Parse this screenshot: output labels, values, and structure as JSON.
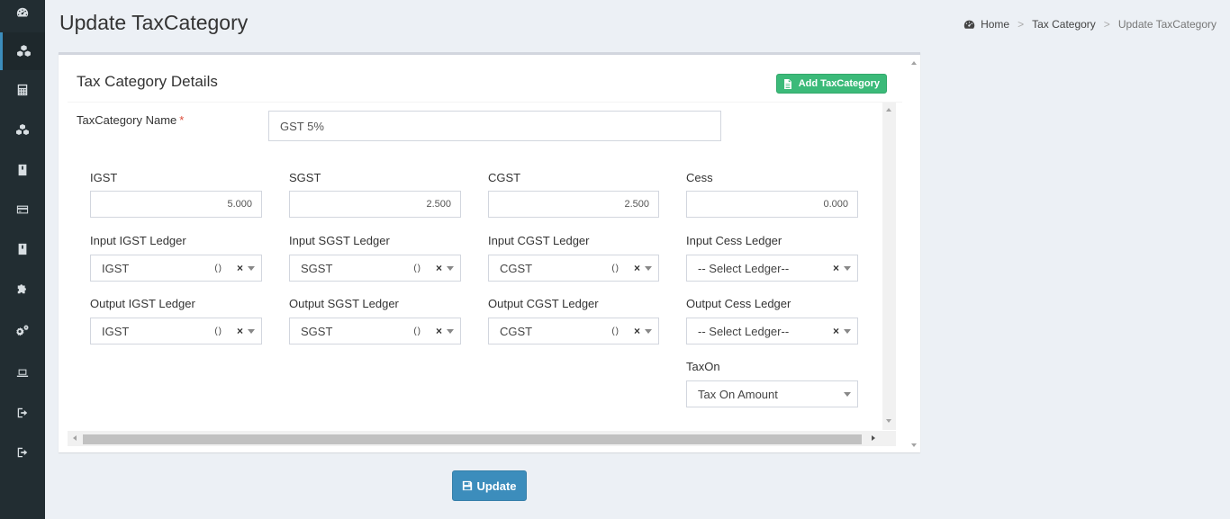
{
  "sidebar": {
    "items": [
      {
        "icon": "dashboard-icon"
      },
      {
        "icon": "cubes-icon",
        "active": true
      },
      {
        "icon": "calculator-icon"
      },
      {
        "icon": "cubes-icon"
      },
      {
        "icon": "book-icon"
      },
      {
        "icon": "credit-card-icon"
      },
      {
        "icon": "book-icon"
      },
      {
        "icon": "puzzle-icon"
      },
      {
        "icon": "cogs-icon"
      },
      {
        "icon": "laptop-icon"
      },
      {
        "icon": "sign-out-icon"
      },
      {
        "icon": "sign-out-icon"
      }
    ]
  },
  "header": {
    "title": "Update TaxCategory",
    "breadcrumb": [
      "Home",
      "Tax Category",
      "Update TaxCategory"
    ]
  },
  "box": {
    "title": "Tax Category Details",
    "add_button": "Add TaxCategory"
  },
  "form": {
    "name_label": "TaxCategory Name",
    "required_mark": "*",
    "name_value": "GST 5%",
    "rates": [
      {
        "label": "IGST",
        "value": "5.000"
      },
      {
        "label": "SGST",
        "value": "2.500"
      },
      {
        "label": "CGST",
        "value": "2.500"
      },
      {
        "label": "Cess",
        "value": "0.000"
      }
    ],
    "input_ledgers": [
      {
        "label": "Input IGST Ledger",
        "value": "IGST",
        "suffix": "()"
      },
      {
        "label": "Input SGST Ledger",
        "value": "SGST",
        "suffix": "()"
      },
      {
        "label": "Input CGST Ledger",
        "value": "CGST",
        "suffix": "()"
      },
      {
        "label": "Input Cess Ledger",
        "value": "-- Select Ledger--",
        "suffix": ""
      }
    ],
    "output_ledgers": [
      {
        "label": "Output IGST Ledger",
        "value": "IGST",
        "suffix": "()"
      },
      {
        "label": "Output SGST Ledger",
        "value": "SGST",
        "suffix": "()"
      },
      {
        "label": "Output CGST Ledger",
        "value": "CGST",
        "suffix": "()"
      },
      {
        "label": "Output Cess Ledger",
        "value": "-- Select Ledger--",
        "suffix": ""
      }
    ],
    "clear_glyph": "×",
    "taxon_label": "TaxOn",
    "taxon_value": "Tax On Amount"
  },
  "update_button": "Update",
  "colors": {
    "sidebar": "#222d32",
    "primary": "#3c8dbc",
    "success": "#3bba79",
    "background": "#ecf0f5"
  }
}
